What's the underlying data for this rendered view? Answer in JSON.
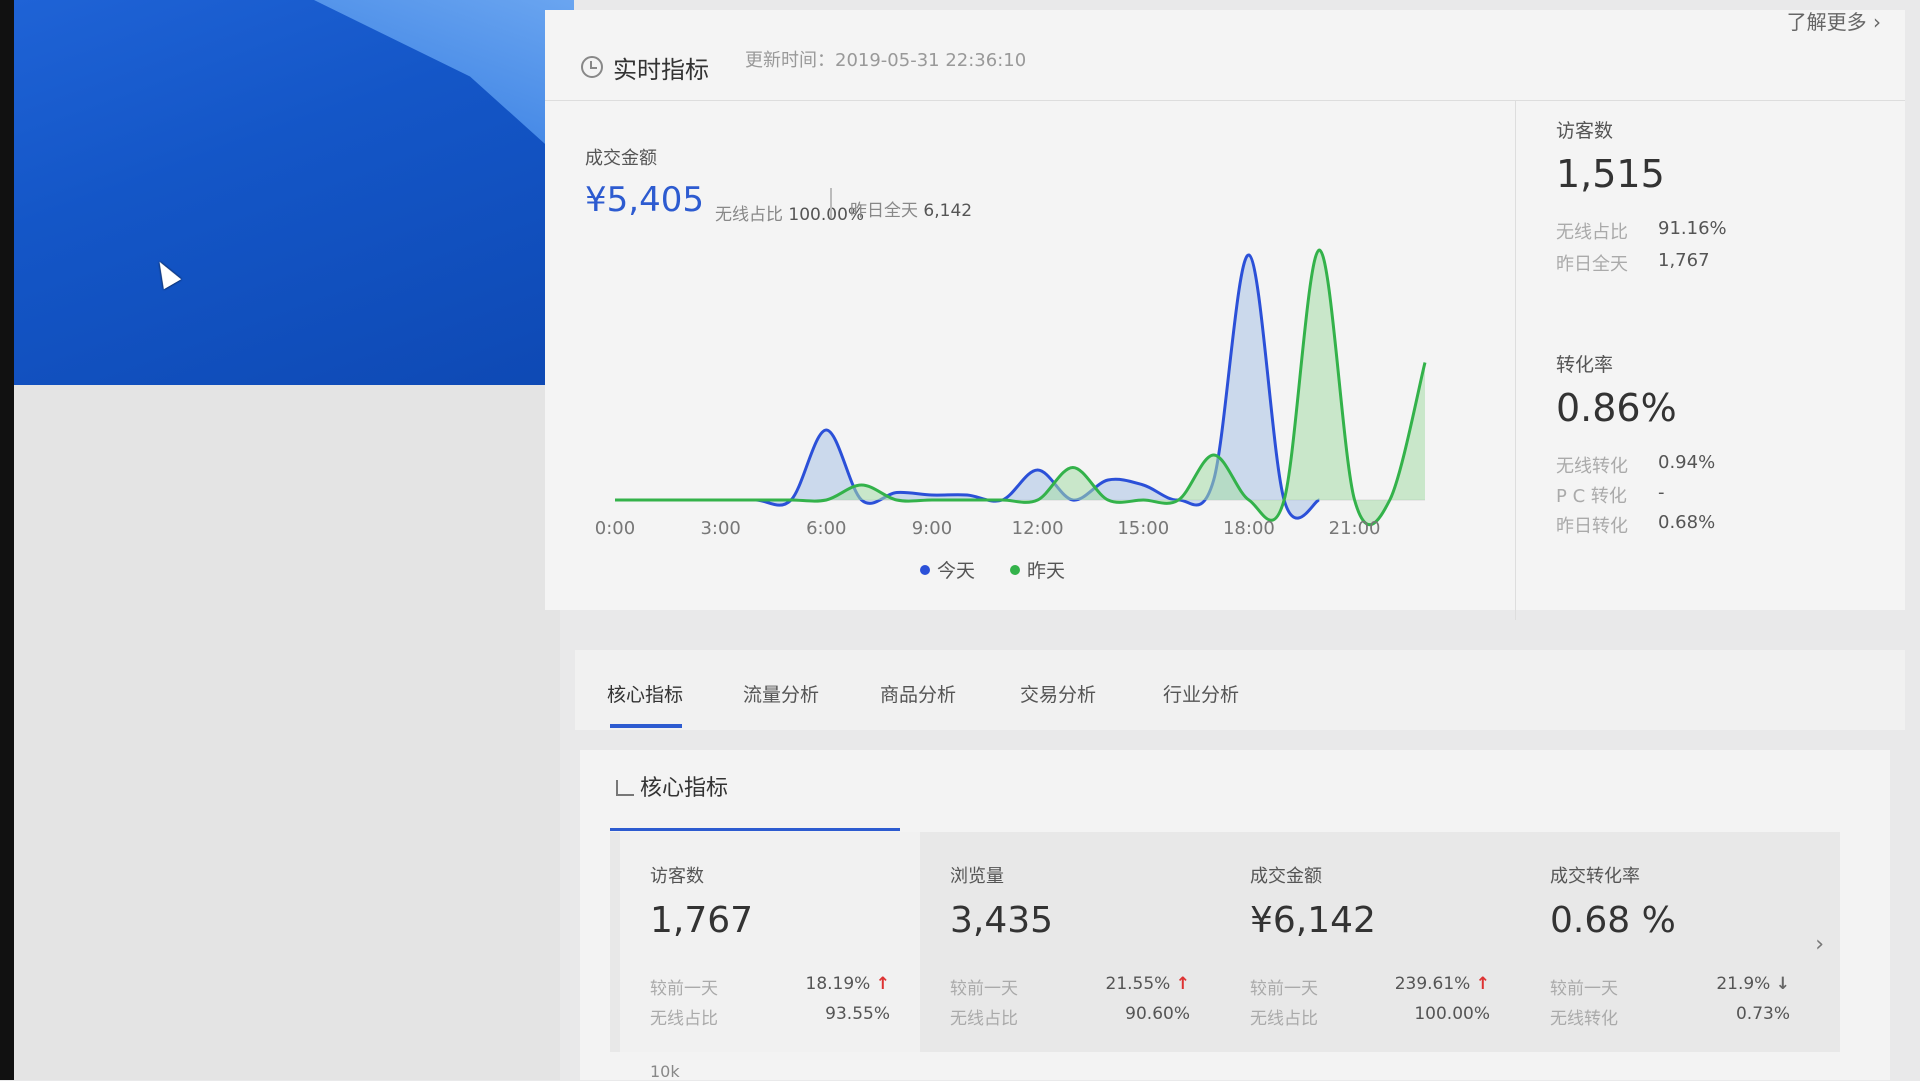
{
  "header": {
    "title": "实时指标",
    "update_time": "更新时间：2019-05-31 22:36:10",
    "more_link": "了解更多 ›"
  },
  "revenue": {
    "label": "成交金额",
    "amount": "¥5,405",
    "wireless_label": "无线占比",
    "wireless_value": "100.00%",
    "yesterday_label": "昨日全天",
    "yesterday_value": "6,142"
  },
  "chart_data": {
    "type": "area",
    "x": [
      "0:00",
      "1:00",
      "2:00",
      "3:00",
      "4:00",
      "5:00",
      "6:00",
      "7:00",
      "8:00",
      "9:00",
      "10:00",
      "11:00",
      "12:00",
      "13:00",
      "14:00",
      "15:00",
      "16:00",
      "17:00",
      "18:00",
      "19:00",
      "20:00",
      "21:00",
      "22:00",
      "23:00"
    ],
    "x_tick_labels": [
      "0:00",
      "3:00",
      "6:00",
      "9:00",
      "12:00",
      "15:00",
      "18:00",
      "21:00"
    ],
    "series": [
      {
        "name": "今天",
        "color": "#2b50d8",
        "fill": "#a9c2e6",
        "values": [
          0,
          0,
          0,
          0,
          0,
          0,
          280,
          0,
          30,
          20,
          20,
          0,
          120,
          0,
          80,
          60,
          0,
          80,
          980,
          0,
          0,
          null,
          null,
          null
        ]
      },
      {
        "name": "昨天",
        "color": "#33b24a",
        "fill": "#a6dca7",
        "values": [
          0,
          0,
          0,
          0,
          0,
          0,
          0,
          60,
          0,
          0,
          0,
          0,
          0,
          130,
          0,
          0,
          0,
          180,
          0,
          0,
          1000,
          0,
          0,
          550
        ]
      }
    ],
    "legend_position": "bottom"
  },
  "visitors": {
    "label": "访客数",
    "value": "1,515",
    "wireless_label": "无线占比",
    "wireless_value": "91.16%",
    "yesterday_label": "昨日全天",
    "yesterday_value": "1,767"
  },
  "conversion": {
    "label": "转化率",
    "value": "0.86%",
    "wireless_label": "无线转化",
    "wireless_value": "0.94%",
    "pc_label": "P C 转化",
    "pc_value": "-",
    "yesterday_label": "昨日转化",
    "yesterday_value": "0.68%"
  },
  "tabs": [
    "核心指标",
    "流量分析",
    "商品分析",
    "交易分析",
    "行业分析"
  ],
  "core": {
    "title": "核心指标",
    "cards": [
      {
        "label": "访客数",
        "value": "1,767",
        "cmp_label": "较前一天",
        "cmp_value": "18.19%",
        "cmp_arrow": "↑",
        "sub_label": "无线占比",
        "sub_value": "93.55%"
      },
      {
        "label": "浏览量",
        "value": "3,435",
        "cmp_label": "较前一天",
        "cmp_value": "21.55%",
        "cmp_arrow": "↑",
        "sub_label": "无线占比",
        "sub_value": "90.60%"
      },
      {
        "label": "成交金额",
        "value": "¥6,142",
        "cmp_label": "较前一天",
        "cmp_value": "239.61%",
        "cmp_arrow": "↑",
        "sub_label": "无线占比",
        "sub_value": "100.00%"
      },
      {
        "label": "成交转化率",
        "value": "0.68 %",
        "cmp_label": "较前一天",
        "cmp_value": "21.9%",
        "cmp_arrow": "↓",
        "sub_label": "无线转化",
        "sub_value": "0.73%"
      }
    ],
    "axis_tick": "10k"
  }
}
